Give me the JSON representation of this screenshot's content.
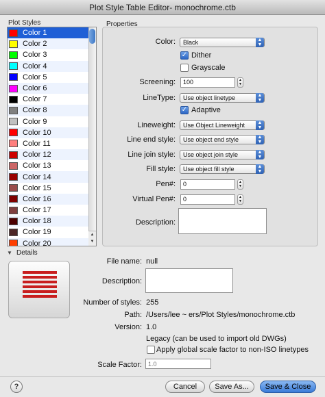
{
  "window": {
    "title": "Plot Style Table Editor- monochrome.ctb"
  },
  "plot_styles": {
    "label": "Plot Styles",
    "items": [
      {
        "label": "Color 1",
        "color": "#ff0000"
      },
      {
        "label": "Color 2",
        "color": "#ffff00"
      },
      {
        "label": "Color 3",
        "color": "#00ff00"
      },
      {
        "label": "Color 4",
        "color": "#00ffff"
      },
      {
        "label": "Color 5",
        "color": "#0000ff"
      },
      {
        "label": "Color 6",
        "color": "#ff00ff"
      },
      {
        "label": "Color 7",
        "color": "#000000"
      },
      {
        "label": "Color 8",
        "color": "#808080"
      },
      {
        "label": "Color 9",
        "color": "#c0c0c0"
      },
      {
        "label": "Color 10",
        "color": "#ff0000"
      },
      {
        "label": "Color 11",
        "color": "#ff7f7f"
      },
      {
        "label": "Color 12",
        "color": "#cc0000"
      },
      {
        "label": "Color 13",
        "color": "#cc6666"
      },
      {
        "label": "Color 14",
        "color": "#990000"
      },
      {
        "label": "Color 15",
        "color": "#994c4c"
      },
      {
        "label": "Color 16",
        "color": "#7f0000"
      },
      {
        "label": "Color 17",
        "color": "#7f3f3f"
      },
      {
        "label": "Color 18",
        "color": "#4c0000"
      },
      {
        "label": "Color 19",
        "color": "#4c2626"
      },
      {
        "label": "Color 20",
        "color": "#ff3f00"
      }
    ],
    "selected_index": 0
  },
  "properties": {
    "label": "Properties",
    "color_label": "Color:",
    "color_value": "Black",
    "dither_label": "Dither",
    "grayscale_label": "Grayscale",
    "screening_label": "Screening:",
    "screening_value": "100",
    "linetype_label": "LineType:",
    "linetype_value": "Use object linetype",
    "adaptive_label": "Adaptive",
    "lineweight_label": "Lineweight:",
    "lineweight_value": "Use Object Lineweight",
    "line_end_label": "Line end style:",
    "line_end_value": "Use object end style",
    "line_join_label": "Line join style:",
    "line_join_value": "Use object join style",
    "fill_style_label": "Fill style:",
    "fill_style_value": "Use object fill style",
    "pen_label": "Pen#:",
    "pen_value": "0",
    "virtual_pen_label": "Virtual Pen#:",
    "virtual_pen_value": "0",
    "description_label": "Description:"
  },
  "details": {
    "label": "Details",
    "file_name_label": "File name:",
    "file_name_value": "null",
    "description_label": "Description:",
    "num_styles_label": "Number of styles:",
    "num_styles_value": "255",
    "path_label": "Path:",
    "path_value": "/Users/lee ~ ers/Plot Styles/monochrome.ctb",
    "version_label": "Version:",
    "version_value": "1.0",
    "legacy_text": "Legacy (can be used to import old DWGs)",
    "apply_scale_label": "Apply global scale factor to non-ISO linetypes",
    "scale_factor_label": "Scale Factor:",
    "scale_factor_placeholder": "1.0"
  },
  "buttons": {
    "help": "?",
    "cancel": "Cancel",
    "save_as": "Save As...",
    "save_close": "Save & Close"
  },
  "colors": {
    "accent": "#1f5fd6",
    "icon_red": "#c81e1e"
  }
}
